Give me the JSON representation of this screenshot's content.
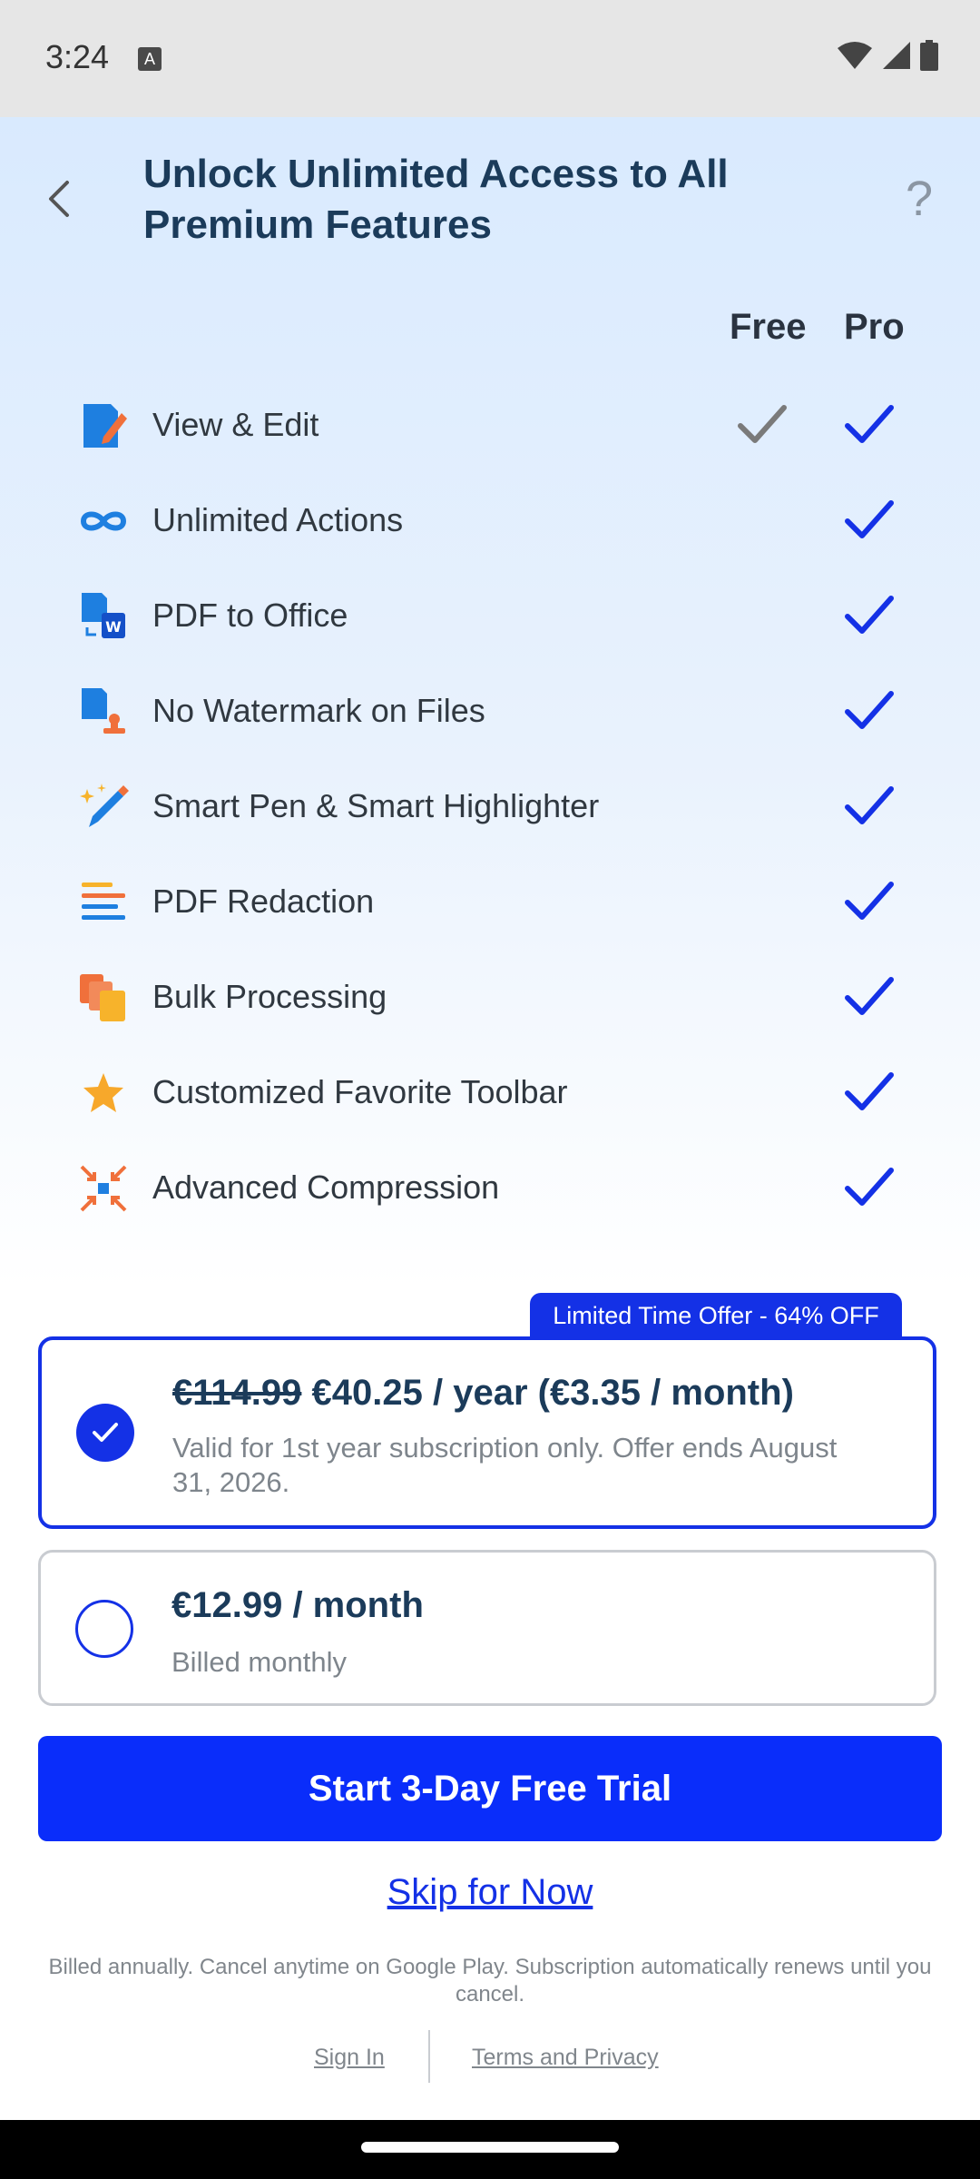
{
  "status_bar": {
    "time": "3:24",
    "notification_glyph": "A"
  },
  "header": {
    "title": "Unlock Unlimited Access to All Premium Features",
    "help_glyph": "?"
  },
  "columns": {
    "free": "Free",
    "pro": "Pro"
  },
  "features": [
    {
      "label": "View & Edit",
      "icon": "view-edit-icon",
      "free": true,
      "pro": true
    },
    {
      "label": "Unlimited Actions",
      "icon": "infinity-icon",
      "free": false,
      "pro": true
    },
    {
      "label": "PDF to Office",
      "icon": "pdf-to-office-icon",
      "free": false,
      "pro": true
    },
    {
      "label": "No Watermark on Files",
      "icon": "no-watermark-icon",
      "free": false,
      "pro": true
    },
    {
      "label": "Smart Pen & Smart Highlighter",
      "icon": "smart-pen-icon",
      "free": false,
      "pro": true
    },
    {
      "label": "PDF Redaction",
      "icon": "redaction-icon",
      "free": false,
      "pro": true
    },
    {
      "label": "Bulk Processing",
      "icon": "bulk-processing-icon",
      "free": false,
      "pro": true
    },
    {
      "label": "Customized Favorite Toolbar",
      "icon": "star-icon",
      "free": false,
      "pro": true
    },
    {
      "label": "Advanced Compression",
      "icon": "compression-icon",
      "free": false,
      "pro": true
    }
  ],
  "offer_badge": "Limited Time Offer - 64% OFF",
  "plans": {
    "yearly": {
      "old_price": "€114.99",
      "price": "€40.25 / year (€3.35 / month)",
      "subtitle": "Valid for 1st year subscription only. Offer ends August 31, 2026."
    },
    "monthly": {
      "price": "€12.99 / month",
      "subtitle": "Billed monthly"
    }
  },
  "cta_label": "Start 3-Day Free Trial",
  "skip_label": "Skip for Now",
  "fineprint": "Billed annually. Cancel anytime on Google Play. Subscription automatically renews until you cancel.",
  "footer": {
    "sign_in": "Sign In",
    "terms": "Terms and Privacy"
  },
  "colors": {
    "accent": "#1431e6",
    "cta": "#0a2dfa",
    "title": "#1b3b5a"
  }
}
